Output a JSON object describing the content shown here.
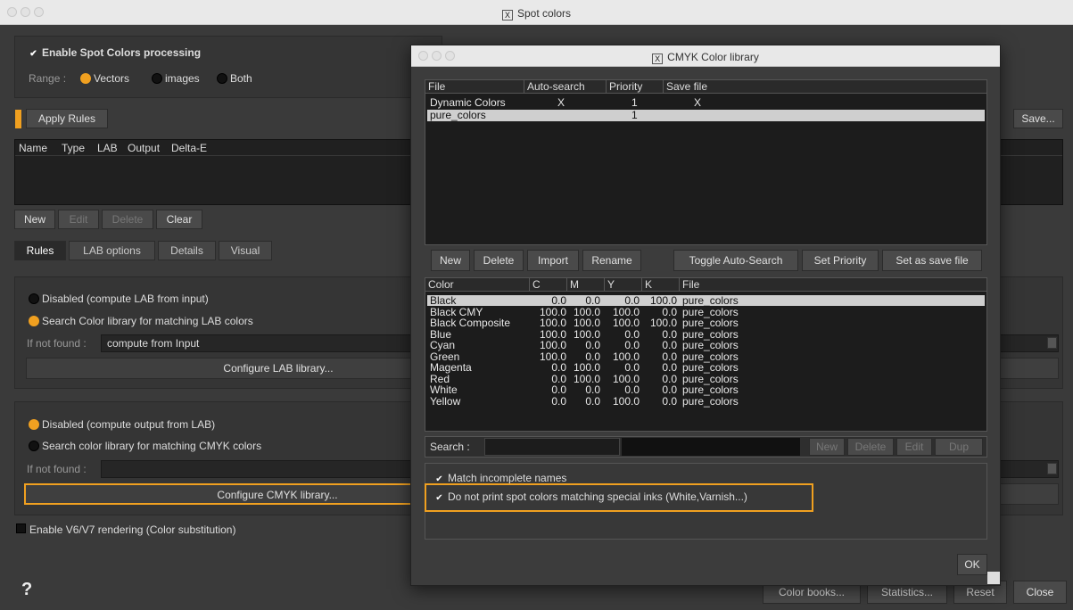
{
  "main": {
    "title": "Spot colors",
    "x_badge": "X",
    "enable_spot": "Enable Spot Colors processing",
    "range_label": "Range :",
    "range_options": [
      "Vectors",
      "images",
      "Both"
    ],
    "apply_rules": "Apply Rules",
    "save": "Save...",
    "table_headers": [
      "Name",
      "Type",
      "LAB",
      "Output",
      "Delta-E"
    ],
    "row_buttons": [
      "New",
      "Edit",
      "Delete",
      "Clear"
    ],
    "tabs": [
      "Rules",
      "LAB options",
      "Details",
      "Visual"
    ],
    "lab_disabled": "Disabled (compute LAB from input)",
    "lab_search": "Search Color library for matching LAB colors",
    "if_not_found": "If not found :",
    "lab_not_found_value": "compute from Input",
    "configure_lab": "Configure LAB library...",
    "out_disabled": "Disabled (compute output from LAB)",
    "out_search": "Search color library for matching CMYK colors",
    "configure_cmyk": "Configure CMYK library...",
    "enable_v6": "Enable V6/V7 rendering (Color substitution)",
    "help": "?",
    "bottom_buttons": [
      "Color books...",
      "Statistics...",
      "Reset",
      "Close"
    ]
  },
  "cmyk": {
    "title": "CMYK Color library",
    "x_badge": "X",
    "files_headers": [
      "File",
      "Auto-search",
      "Priority",
      "Save file"
    ],
    "files": [
      {
        "file": "Dynamic Colors",
        "auto": "X",
        "priority": "1",
        "save": "X"
      },
      {
        "file": "pure_colors",
        "auto": "",
        "priority": "1",
        "save": ""
      }
    ],
    "file_buttons": [
      "New",
      "Delete",
      "Import",
      "Rename",
      "Toggle Auto-Search",
      "Set Priority",
      "Set as save file"
    ],
    "colors_headers": [
      "Color",
      "C",
      "M",
      "Y",
      "K",
      "File"
    ],
    "colors": [
      {
        "name": "Black",
        "c": "0.0",
        "m": "0.0",
        "y": "0.0",
        "k": "100.0",
        "file": "pure_colors"
      },
      {
        "name": "Black CMY",
        "c": "100.0",
        "m": "100.0",
        "y": "100.0",
        "k": "0.0",
        "file": "pure_colors"
      },
      {
        "name": "Black Composite",
        "c": "100.0",
        "m": "100.0",
        "y": "100.0",
        "k": "100.0",
        "file": "pure_colors"
      },
      {
        "name": "Blue",
        "c": "100.0",
        "m": "100.0",
        "y": "0.0",
        "k": "0.0",
        "file": "pure_colors"
      },
      {
        "name": "Cyan",
        "c": "100.0",
        "m": "0.0",
        "y": "0.0",
        "k": "0.0",
        "file": "pure_colors"
      },
      {
        "name": "Green",
        "c": "100.0",
        "m": "0.0",
        "y": "100.0",
        "k": "0.0",
        "file": "pure_colors"
      },
      {
        "name": "Magenta",
        "c": "0.0",
        "m": "100.0",
        "y": "0.0",
        "k": "0.0",
        "file": "pure_colors"
      },
      {
        "name": "Red",
        "c": "0.0",
        "m": "100.0",
        "y": "100.0",
        "k": "0.0",
        "file": "pure_colors"
      },
      {
        "name": "White",
        "c": "0.0",
        "m": "0.0",
        "y": "0.0",
        "k": "0.0",
        "file": "pure_colors"
      },
      {
        "name": "Yellow",
        "c": "0.0",
        "m": "0.0",
        "y": "100.0",
        "k": "0.0",
        "file": "pure_colors"
      }
    ],
    "search_label": "Search :",
    "color_buttons": [
      "New",
      "Delete",
      "Edit",
      "Dup"
    ],
    "match_incomplete": "Match incomplete names",
    "no_print_special": "Do not print spot colors matching special inks (White,Varnish...)",
    "ok": "OK"
  },
  "colors": {
    "accent": "#f0a020",
    "window_bg": "#3a3a3a",
    "list_bg": "#1c1c1c"
  }
}
